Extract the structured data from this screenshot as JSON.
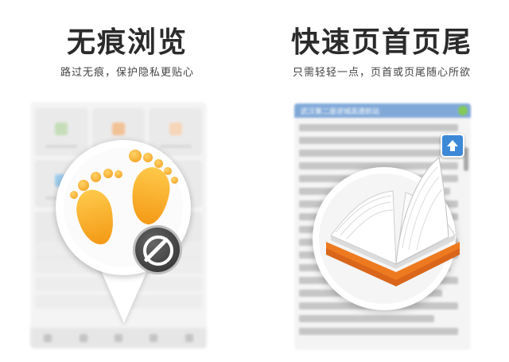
{
  "left_panel": {
    "title": "无痕浏览",
    "subtitle": "路过无痕，保护隐私更贴心",
    "icons": {
      "main": "footprints-icon",
      "overlay": "no-entry-icon"
    },
    "colors": {
      "footprint": "#f5a623",
      "ban": "#333333"
    }
  },
  "right_panel": {
    "title": "快速页首页尾",
    "subtitle": "只需轻轻一点，页首或页尾随心所欲",
    "reader_header": "武汉第二座逆城高速航站",
    "icons": {
      "main": "open-book-icon",
      "button": "arrow-up-icon"
    },
    "colors": {
      "header": "#6c9bd2",
      "book_cover": "#ee7a1f",
      "up_button": "#3d89d8"
    }
  }
}
